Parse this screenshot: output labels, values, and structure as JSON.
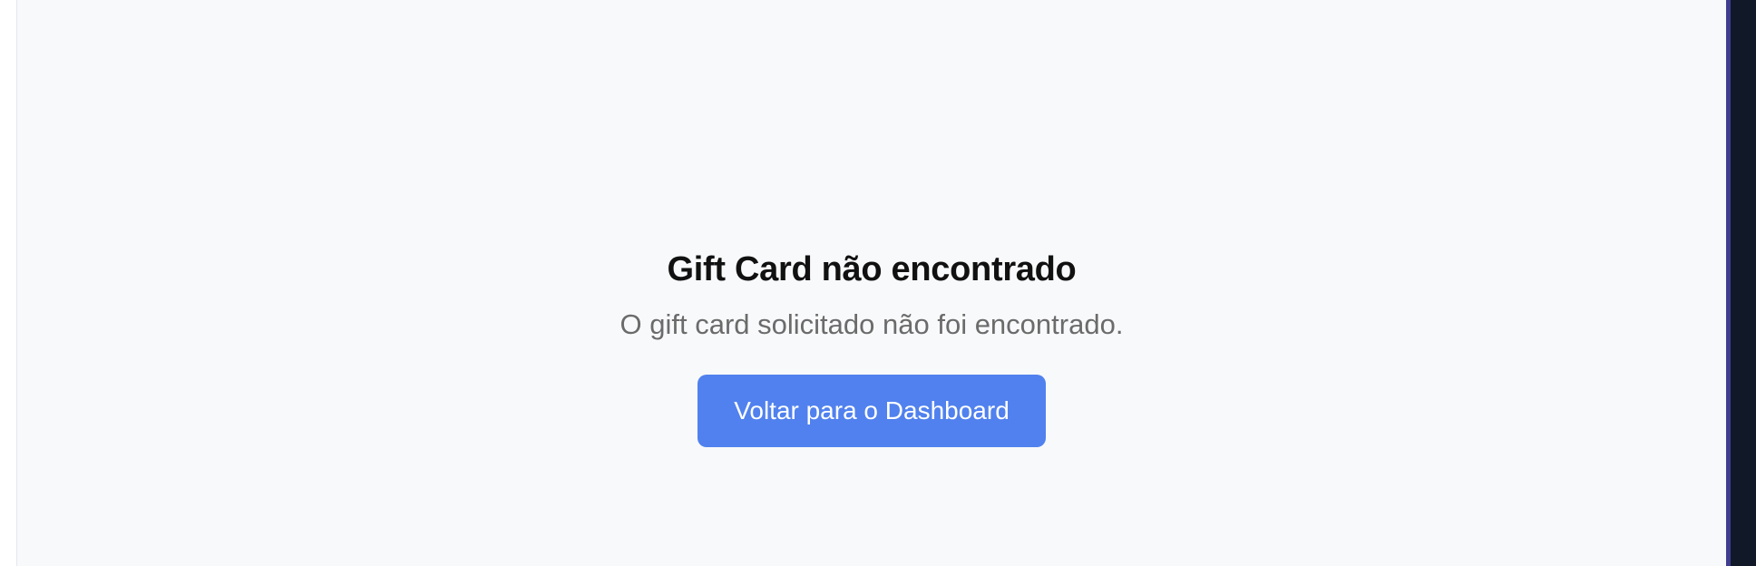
{
  "page": {
    "title": "Gift Card não encontrado",
    "message": "O gift card solicitado não foi encontrado.",
    "back_button_label": "Voltar para o Dashboard"
  },
  "colors": {
    "background": "#f8f9fb",
    "primary_button": "#5081ee",
    "title_text": "#111111",
    "message_text": "#6b6b6b",
    "right_panel": "#111827",
    "right_panel_accent": "#3f3d8f"
  }
}
